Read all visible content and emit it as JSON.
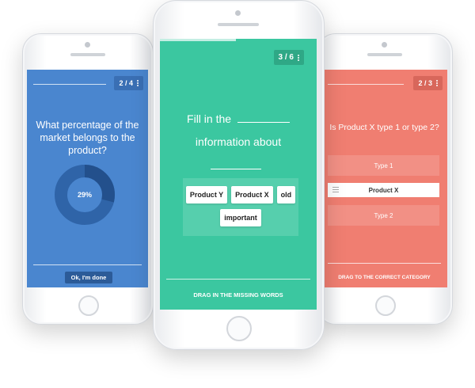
{
  "left": {
    "counter": "2 / 4",
    "question": "What percentage of the market belongs to the product?",
    "donut_label": "29%",
    "donut_value": 0.29,
    "button": "Ok, I'm done",
    "colors": {
      "screen": "#4a86cf",
      "donut_track": "#2f64a8",
      "donut_fill": "#23508c"
    }
  },
  "center": {
    "counter": "3 / 6",
    "sentence": {
      "part1": "Fill in the",
      "part2": "information about"
    },
    "chips": [
      "Product Y",
      "Product X",
      "old",
      "important"
    ],
    "footer": "DRAG IN THE MISSING WORDS",
    "colors": {
      "screen": "#3bc7a0"
    }
  },
  "right": {
    "counter": "2 / 3",
    "question": "Is Product X type 1 or type 2?",
    "categories": [
      "Type 1",
      "Product X",
      "Type 2"
    ],
    "footer": "DRAG TO THE CORRECT CATEGORY",
    "colors": {
      "screen": "#f07e71"
    }
  }
}
